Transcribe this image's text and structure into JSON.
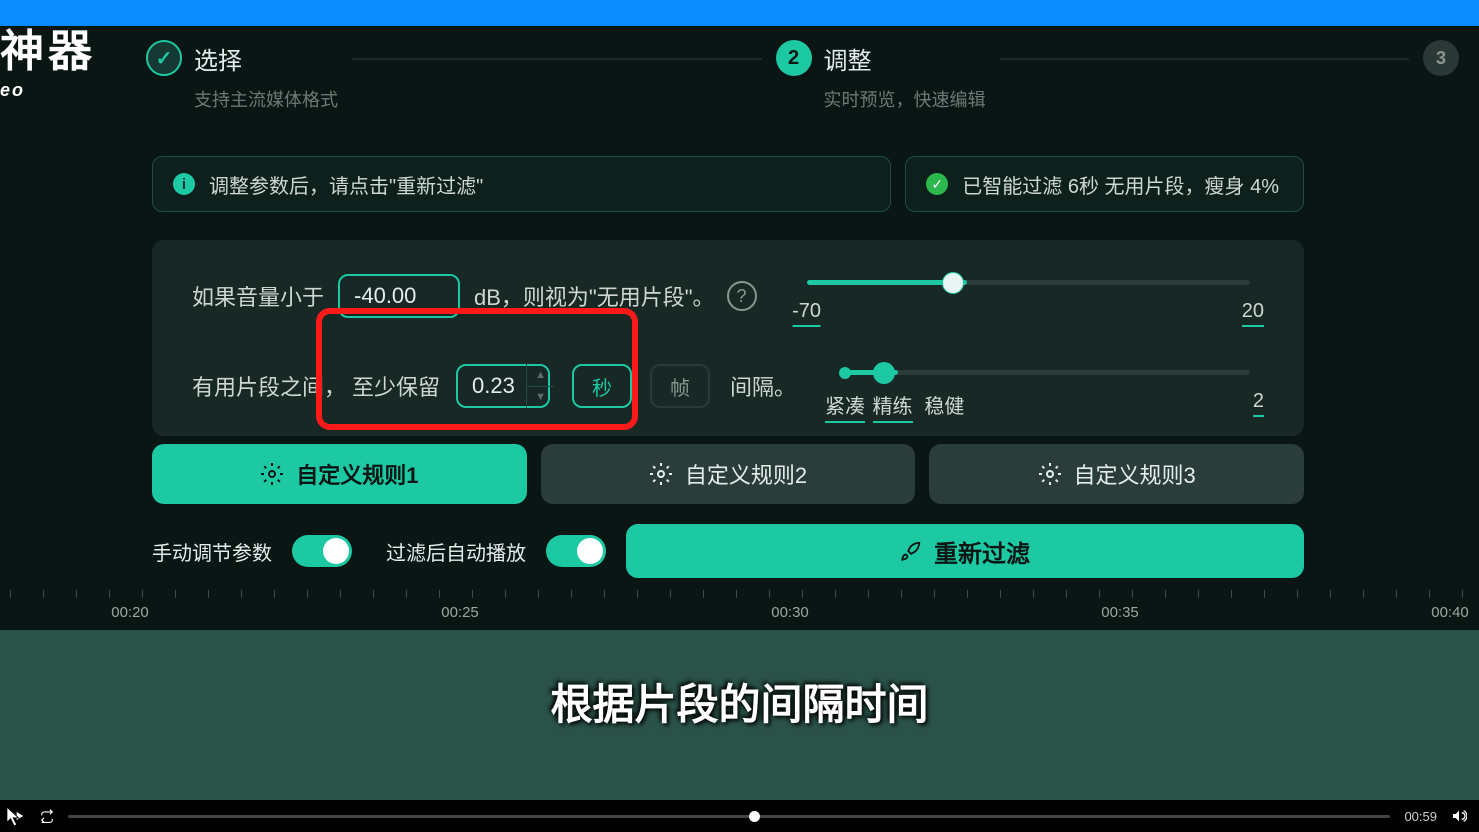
{
  "logo": {
    "big": "神器",
    "sm": "eo"
  },
  "steps": {
    "s1": {
      "title": "选择",
      "sub": "支持主流媒体格式"
    },
    "s2": {
      "num": "2",
      "title": "调整",
      "sub": "实时预览，快速编辑"
    },
    "s3": {
      "num": "3"
    }
  },
  "banner_info": "调整参数后，请点击\"重新过滤\"",
  "banner_ok": "已智能过滤 6秒 无用片段，瘦身 4%",
  "row1": {
    "pre": "如果音量小于",
    "val": "-40.00",
    "post": "dB，则视为\"无用片段\"。",
    "min": "-70",
    "max": "20"
  },
  "row2": {
    "pre": "有用片段之间，",
    "keep": "至少保留",
    "val": "0.23",
    "unit_s": "秒",
    "unit_f": "帧",
    "post": "间隔。",
    "t1": "紧凑",
    "t2": "精练",
    "t3": "稳健",
    "max": "2"
  },
  "rules": {
    "r1": "自定义规则1",
    "r2": "自定义规则2",
    "r3": "自定义规则3"
  },
  "toggles": {
    "manual": "手动调节参数",
    "autoplay": "过滤后自动播放"
  },
  "refilter": "重新过滤",
  "timeline": [
    "00:20",
    "00:25",
    "00:30",
    "00:35",
    "00:40"
  ],
  "subtitle": "根据片段的间隔时间",
  "player": {
    "time": "00:59"
  }
}
